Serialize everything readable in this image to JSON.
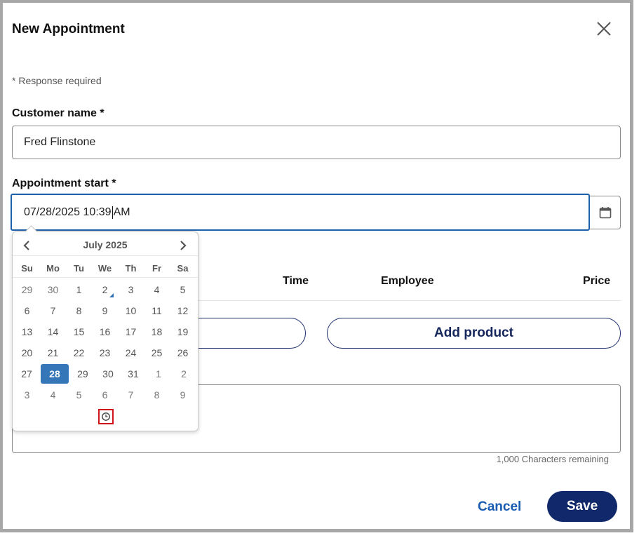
{
  "dialog": {
    "title": "New Appointment",
    "required_note": "* Response required"
  },
  "form": {
    "customer_label": "Customer name *",
    "customer_value": "Fred Flinstone",
    "start_label": "Appointment start *",
    "start_value_before_caret": "07/28/2025 10:39",
    "start_value_after_caret": "AM"
  },
  "table": {
    "headers": {
      "time": "Time",
      "employee": "Employee",
      "price": "Price"
    }
  },
  "buttons": {
    "add_product": "Add product",
    "cancel": "Cancel",
    "save": "Save"
  },
  "notes": {
    "chars_remaining": "1,000 Characters remaining"
  },
  "calendar": {
    "month_label": "July 2025",
    "weekdays": [
      "Su",
      "Mo",
      "Tu",
      "We",
      "Th",
      "Fr",
      "Sa"
    ],
    "weeks": [
      [
        {
          "d": "29",
          "o": true
        },
        {
          "d": "30",
          "o": true
        },
        {
          "d": "1"
        },
        {
          "d": "2",
          "today": true
        },
        {
          "d": "3"
        },
        {
          "d": "4"
        },
        {
          "d": "5"
        }
      ],
      [
        {
          "d": "6"
        },
        {
          "d": "7"
        },
        {
          "d": "8"
        },
        {
          "d": "9"
        },
        {
          "d": "10"
        },
        {
          "d": "11"
        },
        {
          "d": "12"
        }
      ],
      [
        {
          "d": "13"
        },
        {
          "d": "14"
        },
        {
          "d": "15"
        },
        {
          "d": "16"
        },
        {
          "d": "17"
        },
        {
          "d": "18"
        },
        {
          "d": "19"
        }
      ],
      [
        {
          "d": "20"
        },
        {
          "d": "21"
        },
        {
          "d": "22"
        },
        {
          "d": "23"
        },
        {
          "d": "24"
        },
        {
          "d": "25"
        },
        {
          "d": "26"
        }
      ],
      [
        {
          "d": "27"
        },
        {
          "d": "28",
          "sel": true
        },
        {
          "d": "29"
        },
        {
          "d": "30"
        },
        {
          "d": "31"
        },
        {
          "d": "1",
          "o": true
        },
        {
          "d": "2",
          "o": true
        }
      ],
      [
        {
          "d": "3",
          "o": true
        },
        {
          "d": "4",
          "o": true
        },
        {
          "d": "5",
          "o": true
        },
        {
          "d": "6",
          "o": true
        },
        {
          "d": "7",
          "o": true
        },
        {
          "d": "8",
          "o": true
        },
        {
          "d": "9",
          "o": true
        }
      ]
    ]
  },
  "colors": {
    "accent_blue": "#1d5fa8",
    "navy": "#11296b",
    "selected_day": "#3476b8",
    "focus_highlight": "#d0141c"
  },
  "icons": {
    "close": "close-icon",
    "calendar": "calendar-icon",
    "prev": "chevron-left-icon",
    "next": "chevron-right-icon",
    "clock": "clock-icon"
  }
}
